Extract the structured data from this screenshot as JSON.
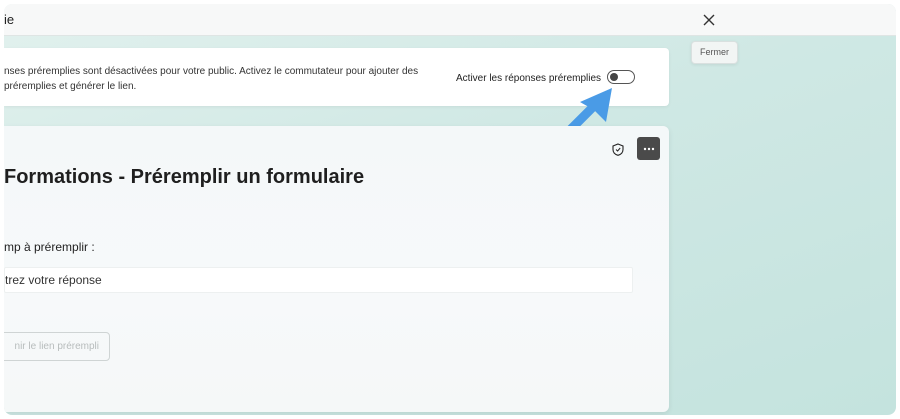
{
  "window": {
    "title": "ie",
    "close_tooltip": "Fermer"
  },
  "banner": {
    "message_line1": "nses préremplies sont désactivées pour votre public. Activez le commutateur pour ajouter des",
    "message_line2": "préremplies et générer le lien.",
    "toggle_label": "Activer les réponses préremplies",
    "toggle_on": false
  },
  "form": {
    "title": "Formations - Préremplir un formulaire",
    "question_label": "mp à préremplir :",
    "answer_placeholder": "trez votre réponse",
    "get_link_button": "nir le lien prérempli"
  },
  "colors": {
    "arrow": "#4a9be6",
    "more_button_bg": "#4a4a4a"
  },
  "icons": {
    "close": "close-icon",
    "shield": "shield-icon",
    "more": "more-icon",
    "arrow": "pointer-arrow-icon"
  }
}
